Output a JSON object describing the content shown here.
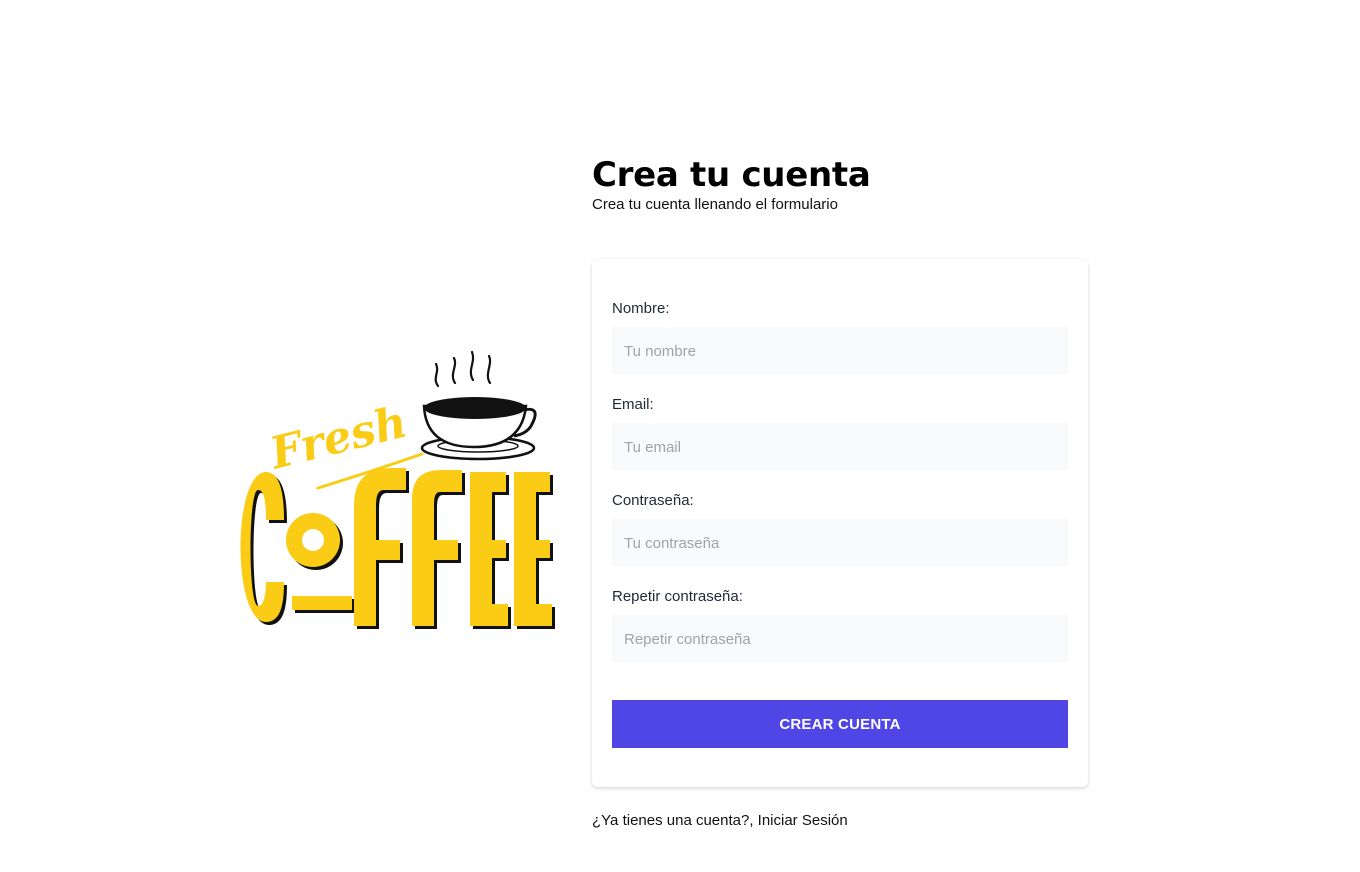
{
  "logo": {
    "script_text": "Fresh",
    "main_text": "COFFEE",
    "accent_color": "#FACC15",
    "icon": "coffee-cup-icon"
  },
  "header": {
    "title": "Crea tu cuenta",
    "subtitle": "Crea tu cuenta llenando el formulario"
  },
  "form": {
    "fields": [
      {
        "label": "Nombre:",
        "placeholder": "Tu nombre",
        "value": ""
      },
      {
        "label": "Email:",
        "placeholder": "Tu email",
        "value": ""
      },
      {
        "label": "Contraseña:",
        "placeholder": "Tu contraseña",
        "value": ""
      },
      {
        "label": "Repetir contraseña:",
        "placeholder": "Repetir contraseña",
        "value": ""
      }
    ],
    "submit_label": "Crear Cuenta",
    "submit_color": "#4F46E5"
  },
  "footer": {
    "login_link": "¿Ya tienes una cuenta?, Iniciar Sesión"
  }
}
